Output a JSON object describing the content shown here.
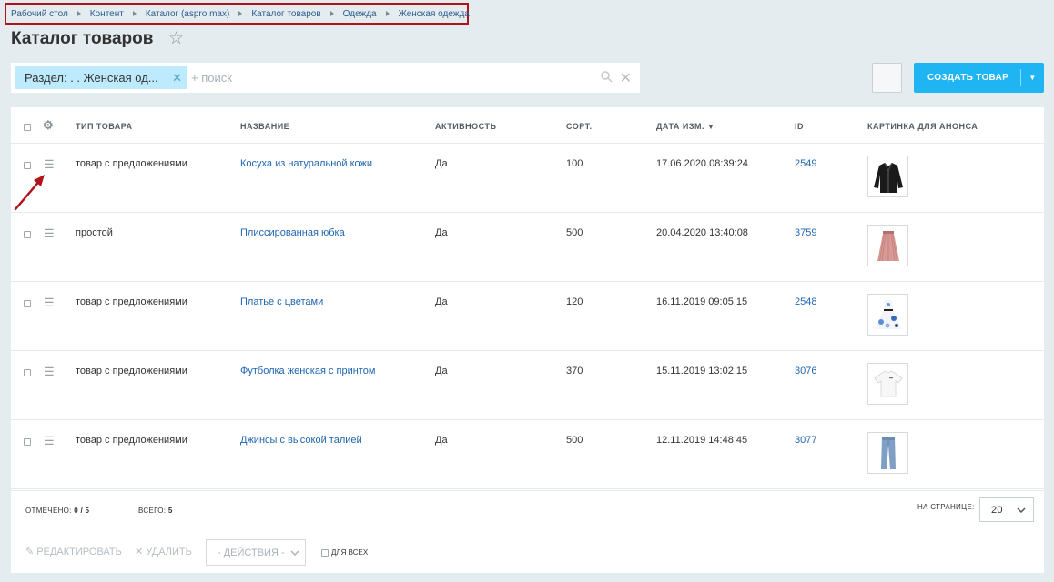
{
  "breadcrumb": [
    "Рабочий стол",
    "Контент",
    "Каталог (aspro.max)",
    "Каталог товаров",
    "Одежда",
    "Женская одежда"
  ],
  "page": {
    "title": "Каталог товаров"
  },
  "filter": {
    "tag_label": "Раздел: . . Женская од...",
    "search_placeholder": "+ поиск"
  },
  "toolbar": {
    "create_label": "СОЗДАТЬ ТОВАР"
  },
  "columns": {
    "type": "ТИП ТОВАРА",
    "name": "НАЗВАНИЕ",
    "active": "АКТИВНОСТЬ",
    "sort": "СОРТ.",
    "date": "ДАТА ИЗМ.",
    "id": "ID",
    "picture": "КАРТИНКА ДЛЯ АНОНСА"
  },
  "rows": [
    {
      "type": "товар с предложениями",
      "name": "Косуха из натуральной кожи",
      "active": "Да",
      "sort": "100",
      "date": "17.06.2020 08:39:24",
      "id": "2549",
      "picture": "leather-jacket"
    },
    {
      "type": "простой",
      "name": "Плиссированная юбка",
      "active": "Да",
      "sort": "500",
      "date": "20.04.2020 13:40:08",
      "id": "3759",
      "picture": "pleated-skirt"
    },
    {
      "type": "товар с предложениями",
      "name": "Платье с цветами",
      "active": "Да",
      "sort": "120",
      "date": "16.11.2019 09:05:15",
      "id": "2548",
      "picture": "floral-dress"
    },
    {
      "type": "товар с предложениями",
      "name": "Футболка женская с принтом",
      "active": "Да",
      "sort": "370",
      "date": "15.11.2019 13:02:15",
      "id": "3076",
      "picture": "white-tshirt"
    },
    {
      "type": "товар с предложениями",
      "name": "Джинсы с высокой талией",
      "active": "Да",
      "sort": "500",
      "date": "12.11.2019 14:48:45",
      "id": "3077",
      "picture": "blue-jeans"
    }
  ],
  "footer": {
    "selected_label": "ОТМЕЧЕНО:",
    "selected_value": "0 / 5",
    "total_label": "ВСЕГО:",
    "total_value": "5",
    "per_page_label": "НА СТРАНИЦЕ:",
    "per_page_value": "20"
  },
  "actions": {
    "edit_label": "РЕДАКТИРОВАТЬ",
    "delete_label": "УДАЛИТЬ",
    "actions_select": "- ДЕЙСТВИЯ -",
    "for_all_label": "ДЛЯ ВСЕХ"
  },
  "colors": {
    "accent": "#1fb5f2",
    "link": "#2066b0",
    "tag_bg": "#bdeafc",
    "annotation": "#b0141a"
  }
}
